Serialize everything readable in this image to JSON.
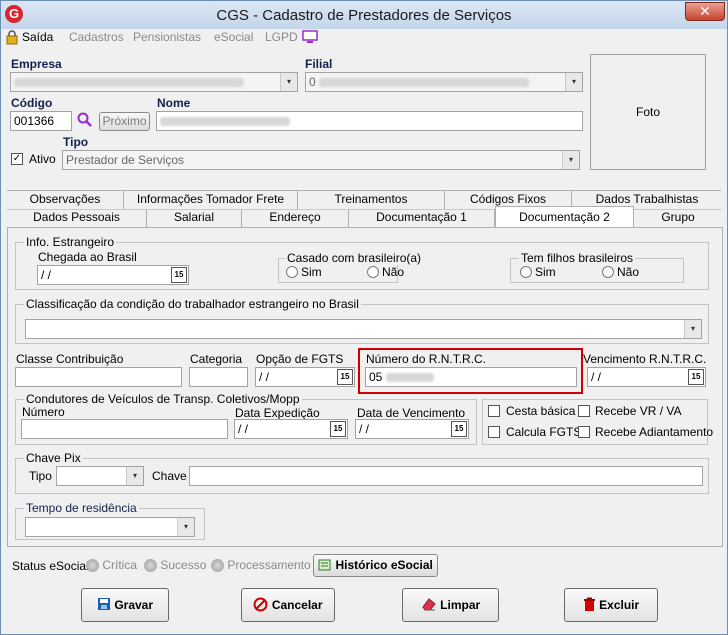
{
  "window": {
    "title": "CGS - Cadastro de Prestadores de Serviços",
    "logo": "G",
    "close": "✕"
  },
  "menu": {
    "saida": "Saída",
    "cadastros": "Cadastros",
    "pensionistas": "Pensionistas",
    "esocial": "eSocial",
    "lgpd": "LGPD"
  },
  "header": {
    "empresa_label": "Empresa",
    "filial_label": "Filial",
    "empresa_value": "",
    "filial_value": "0",
    "codigo_label": "Código",
    "codigo_value": "001366",
    "proximo": "Próximo",
    "nome_label": "Nome",
    "nome_value": "",
    "ativo_label": "Ativo",
    "tipo_label": "Tipo",
    "tipo_value": "Prestador de Serviços",
    "foto": "Foto"
  },
  "tabs_row1": [
    "Observações",
    "Informações Tomador Frete",
    "Treinamentos",
    "Códigos Fixos",
    "Dados Trabalhistas"
  ],
  "tabs_row2": [
    "Dados Pessoais",
    "Salarial",
    "Endereço",
    "Documentação 1",
    "Documentação 2",
    "Grupo"
  ],
  "estrangeiro": {
    "group": "Info. Estrangeiro",
    "chegada_label": "Chegada ao Brasil",
    "chegada_value": " /  /",
    "casado_group": "Casado com brasileiro(a)",
    "sim": "Sim",
    "nao": "Não",
    "filhos_group": "Tem filhos brasileiros"
  },
  "classificacao": {
    "group": "Classificação da condição do trabalhador estrangeiro no Brasil",
    "value": ""
  },
  "contrib": {
    "classe_label": "Classe Contribuição",
    "categoria_label": "Categoria",
    "fgts_label": "Opção de FGTS",
    "fgts_value": " /  /",
    "rntrc_label": "Número do R.N.T.R.C.",
    "rntrc_value": "05",
    "venc_rntrc_label": "Vencimento R.N.T.R.C.",
    "venc_rntrc_value": " /  /"
  },
  "condutores": {
    "group": "Condutores de Veículos de Transp. Coletivos/Mopp",
    "numero_label": "Número",
    "expedicao_label": "Data Expedição",
    "expedicao_value": " /  /",
    "vencimento_label": "Data de Vencimento",
    "vencimento_value": " /  /"
  },
  "checks": {
    "cesta": "Cesta básica",
    "vr": "Recebe VR / VA",
    "fgts": "Calcula FGTS",
    "adiant": "Recebe Adiantamento"
  },
  "pix": {
    "group": "Chave Pix",
    "tipo_label": "Tipo",
    "chave_label": "Chave"
  },
  "residencia": {
    "group": "Tempo de residência"
  },
  "status": {
    "label": "Status eSocial:",
    "critica": "Crítica",
    "sucesso": "Sucesso",
    "processamento": "Processamento",
    "historico": "Histórico eSocial"
  },
  "actions": {
    "gravar": "Gravar",
    "cancelar": "Cancelar",
    "limpar": "Limpar",
    "excluir": "Excluir"
  },
  "calendar_glyph": "15",
  "dropdown_glyph": "▾",
  "check_glyph": "✓",
  "colors": {
    "highlight": "#d00000",
    "link_violet": "#9a2bd1",
    "title_label": "#14224a"
  }
}
